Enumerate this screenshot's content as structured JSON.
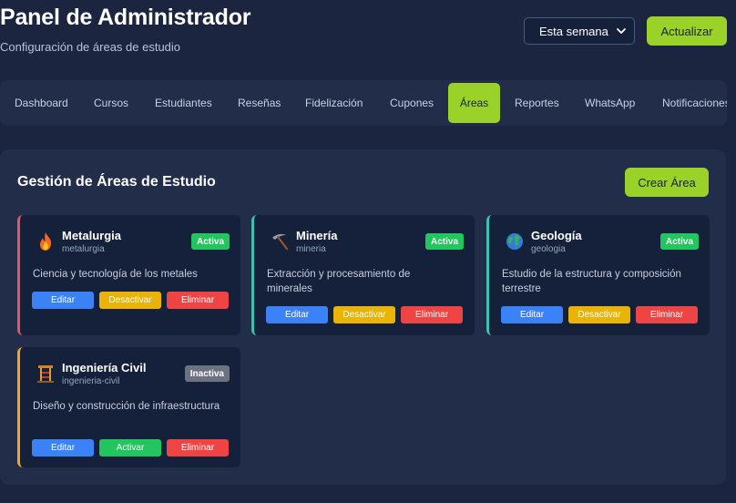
{
  "header": {
    "title": "Panel de Administrador",
    "subtitle": "Configuración de áreas de estudio",
    "period_select": "Esta semana",
    "refresh_label": "Actualizar"
  },
  "nav": {
    "items": [
      "Dashboard",
      "Cursos",
      "Estudiantes",
      "Reseñas",
      "Fidelización",
      "Cupones",
      "Áreas",
      "Reportes",
      "WhatsApp",
      "Notificaciones"
    ],
    "active": "Áreas"
  },
  "panel": {
    "title": "Gestión de Áreas de Estudio",
    "create_label": "Crear Área"
  },
  "cards": [
    {
      "name": "Metalurgia",
      "slug": "metalurgia",
      "icon": "fire-icon",
      "status": "Activa",
      "desc": "Ciencia y tecnología de los metales",
      "accent": "#e25860",
      "status_color": "#22c55e",
      "edit": "Editar",
      "toggle": "Desactivar",
      "delete": "Eliminar"
    },
    {
      "name": "Minería",
      "slug": "mineria",
      "icon": "pickaxe-icon",
      "status": "Activa",
      "desc": "Extracción y procesamiento de minerales",
      "accent": "#3fbfb5",
      "status_color": "#22c55e",
      "edit": "Editar",
      "toggle": "Desactivar",
      "delete": "Eliminar"
    },
    {
      "name": "Geología",
      "slug": "geologia",
      "icon": "globe-icon",
      "status": "Activa",
      "desc": "Estudio de la estructura y composición terrestre",
      "accent": "#3fbfb5",
      "status_color": "#22c55e",
      "edit": "Editar",
      "toggle": "Desactivar",
      "delete": "Eliminar"
    },
    {
      "name": "Ingeniería Civil",
      "slug": "ingenieria-civil",
      "icon": "construction-icon",
      "status": "Inactiva",
      "desc": "Diseño y construcción de infraestructura",
      "accent": "#f5a524",
      "status_color": "#6b7280",
      "edit": "Editar",
      "toggle": "Activar",
      "delete": "Eliminar"
    }
  ]
}
